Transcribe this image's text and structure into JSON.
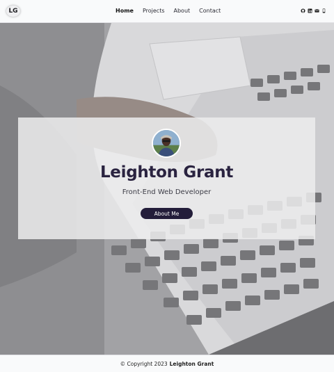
{
  "header": {
    "logo": "LG",
    "nav": [
      {
        "label": "Home",
        "active": true
      },
      {
        "label": "Projects",
        "active": false
      },
      {
        "label": "About",
        "active": false
      },
      {
        "label": "Contact",
        "active": false
      }
    ],
    "social_icons": [
      "github-icon",
      "linkedin-icon",
      "email-icon",
      "phone-icon"
    ]
  },
  "hero": {
    "name": "Leighton Grant",
    "role": "Front-End Web Developer",
    "cta_label": "About Me"
  },
  "footer": {
    "copyright": "© Copyright 2023",
    "name": "Leighton Grant"
  },
  "colors": {
    "accent": "#231d3a",
    "name_text": "#2a2340",
    "nav_bg": "#f9fafb"
  }
}
